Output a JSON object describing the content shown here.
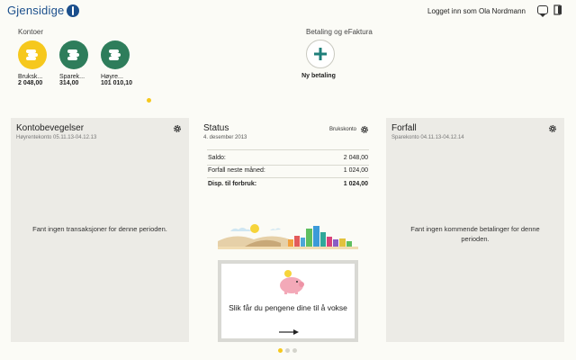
{
  "header": {
    "brand": "Gjensidige",
    "logged_in": "Logget inn som Ola Nordmann",
    "icons": [
      "chat-icon",
      "logout-icon"
    ]
  },
  "accounts": {
    "label": "Kontoer",
    "items": [
      {
        "name": "Bruksk...",
        "amount": "2 048,00",
        "color": "#f6c81d"
      },
      {
        "name": "Sparek...",
        "amount": "314,00",
        "color": "#2e7d5b"
      },
      {
        "name": "Høyre...",
        "amount": "101 010,10",
        "color": "#2e7d5b"
      }
    ]
  },
  "payments": {
    "label": "Betaling og eFaktura",
    "new_payment": "Ny betaling"
  },
  "kontobevegelser": {
    "title": "Kontobevegelser",
    "subtitle": "Høyrentekonto 05.11.13-04.12.13",
    "empty": "Fant ingen transaksjoner for denne perioden."
  },
  "status": {
    "title": "Status",
    "date": "4. desember 2013",
    "account": "Brukskonto",
    "rows": [
      {
        "label": "Saldo:",
        "value": "2 048,00"
      },
      {
        "label": "Forfall neste måned:",
        "value": "1 024,00"
      },
      {
        "label": "Disp. til forbruk:",
        "value": "1 024,00"
      }
    ],
    "tip": "Slik får du pengene dine til å vokse"
  },
  "forfall": {
    "title": "Forfall",
    "subtitle": "Sparekonto 04.11.13-04.12.14",
    "empty": "Fant ingen kommende betalinger for denne perioden."
  },
  "colors": {
    "brand": "#1b4f8c",
    "accent_yellow": "#f6c81d",
    "account_green": "#2e7d5b",
    "plus_teal": "#1f7f7a",
    "card_bg": "#ecebe6"
  }
}
